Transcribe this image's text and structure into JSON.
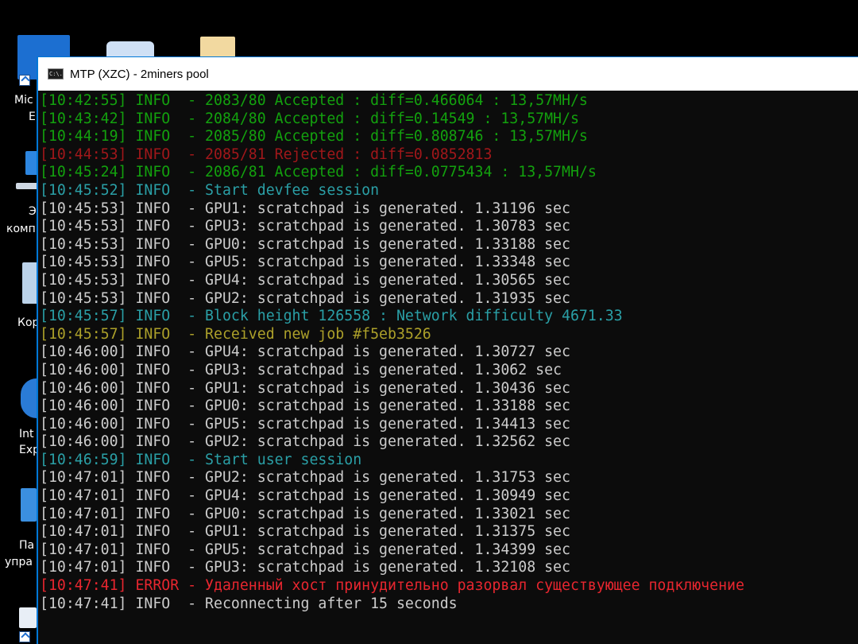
{
  "desktop": {
    "icons": [
      {
        "label": "Mic",
        "label2": "E",
        "color": "#1c6fd1"
      },
      {
        "label": "Э",
        "label2": "комп",
        "color": "#cfd8e3"
      },
      {
        "label": "Кор",
        "label2": "",
        "color": "#bcd3ea"
      },
      {
        "label": "Int",
        "label2": "Exp",
        "color": "#2a7bd6"
      },
      {
        "label": "Па",
        "label2": "упра",
        "color": "#3b8fe0"
      }
    ]
  },
  "window": {
    "title": "MTP (XZC) - 2miners pool",
    "icon_name": "console-icon",
    "icon_text": "C:\\."
  },
  "colors": {
    "info": "#cccccc",
    "accepted": "#13a10e",
    "rejected": "#a0171a",
    "session": "#2a9fa6",
    "job": "#aca02a",
    "error": "#e8262f",
    "titlebar_border": "#0078d7"
  },
  "log": [
    {
      "type": "accepted",
      "text": "[10:42:55] INFO  - 2083/80 Accepted : diff=0.466064 : 13,57MH/s"
    },
    {
      "type": "accepted",
      "text": "[10:43:42] INFO  - 2084/80 Accepted : diff=0.14549 : 13,57MH/s"
    },
    {
      "type": "accepted",
      "text": "[10:44:19] INFO  - 2085/80 Accepted : diff=0.808746 : 13,57MH/s"
    },
    {
      "type": "rejected",
      "text": "[10:44:53] INFO  - 2085/81 Rejected : diff=0.0852813"
    },
    {
      "type": "accepted",
      "text": "[10:45:24] INFO  - 2086/81 Accepted : diff=0.0775434 : 13,57MH/s"
    },
    {
      "type": "session",
      "text": "[10:45:52] INFO  - Start devfee session"
    },
    {
      "type": "info",
      "text": "[10:45:53] INFO  - GPU1: scratchpad is generated. 1.31196 sec"
    },
    {
      "type": "info",
      "text": "[10:45:53] INFO  - GPU3: scratchpad is generated. 1.30783 sec"
    },
    {
      "type": "info",
      "text": "[10:45:53] INFO  - GPU0: scratchpad is generated. 1.33188 sec"
    },
    {
      "type": "info",
      "text": "[10:45:53] INFO  - GPU5: scratchpad is generated. 1.33348 sec"
    },
    {
      "type": "info",
      "text": "[10:45:53] INFO  - GPU4: scratchpad is generated. 1.30565 sec"
    },
    {
      "type": "info",
      "text": "[10:45:53] INFO  - GPU2: scratchpad is generated. 1.31935 sec"
    },
    {
      "type": "session",
      "text": "[10:45:57] INFO  - Block height 126558 : Network difficulty 4671.33"
    },
    {
      "type": "job",
      "text": "[10:45:57] INFO  - Received new job #f5eb3526"
    },
    {
      "type": "info",
      "text": "[10:46:00] INFO  - GPU4: scratchpad is generated. 1.30727 sec"
    },
    {
      "type": "info",
      "text": "[10:46:00] INFO  - GPU3: scratchpad is generated. 1.3062 sec"
    },
    {
      "type": "info",
      "text": "[10:46:00] INFO  - GPU1: scratchpad is generated. 1.30436 sec"
    },
    {
      "type": "info",
      "text": "[10:46:00] INFO  - GPU0: scratchpad is generated. 1.33188 sec"
    },
    {
      "type": "info",
      "text": "[10:46:00] INFO  - GPU5: scratchpad is generated. 1.34413 sec"
    },
    {
      "type": "info",
      "text": "[10:46:00] INFO  - GPU2: scratchpad is generated. 1.32562 sec"
    },
    {
      "type": "session",
      "text": "[10:46:59] INFO  - Start user session"
    },
    {
      "type": "info",
      "text": "[10:47:01] INFO  - GPU2: scratchpad is generated. 1.31753 sec"
    },
    {
      "type": "info",
      "text": "[10:47:01] INFO  - GPU4: scratchpad is generated. 1.30949 sec"
    },
    {
      "type": "info",
      "text": "[10:47:01] INFO  - GPU0: scratchpad is generated. 1.33021 sec"
    },
    {
      "type": "info",
      "text": "[10:47:01] INFO  - GPU1: scratchpad is generated. 1.31375 sec"
    },
    {
      "type": "info",
      "text": "[10:47:01] INFO  - GPU5: scratchpad is generated. 1.34399 sec"
    },
    {
      "type": "info",
      "text": "[10:47:01] INFO  - GPU3: scratchpad is generated. 1.32108 sec"
    },
    {
      "type": "error",
      "text": "[10:47:41] ERROR - Удаленный хост принудительно разорвал существующее подключение"
    },
    {
      "type": "info",
      "text": "[10:47:41] INFO  - Reconnecting after 15 seconds"
    }
  ]
}
